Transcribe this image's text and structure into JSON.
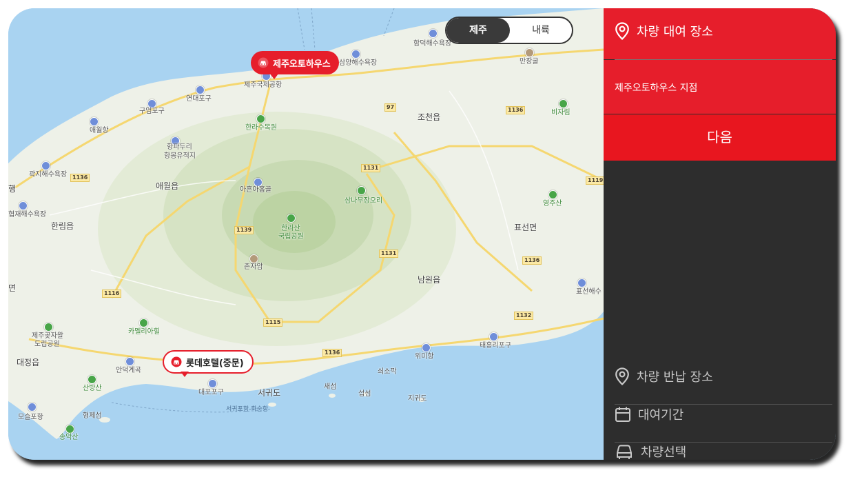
{
  "map": {
    "region_toggle": {
      "selected": "제주",
      "other": "내륙"
    },
    "markers": {
      "pickup": "제주오토하우스",
      "other": "롯데호텔(중문)"
    },
    "labels": {
      "airport": "제주국제공항",
      "hamdeok": "함덕해수욕장",
      "samyang": "삼양해수욕장",
      "manjang": "만장굴",
      "yeondae": "연대포구",
      "gueom": "구엄포구",
      "aewol_port": "애월항",
      "arboretum": "한라수목원",
      "jocheon": "조천읍",
      "bijarim": "비자림",
      "hangpadu1": "항파두리",
      "hangpadu2": "항몽유적지",
      "gwakji": "곽지해수욕장",
      "aewol": "애월읍",
      "hyeopjae": "협재해수욕장",
      "hallim": "한림읍",
      "aheun": "아흔아홉골",
      "samnun": "삼나무장오리",
      "hallasan1": "한라산",
      "hallasan2": "국립공원",
      "yeongju": "영주산",
      "pyoseon": "표선면",
      "jonjaam": "존자암",
      "namwon": "남원읍",
      "pyoseonhae": "표선해수",
      "jeju_got1": "제주곶자왈",
      "jeju_got2": "도립공원",
      "camellia": "카멜리아힐",
      "taeheung": "태흥리포구",
      "wimi": "위미항",
      "daejeong": "대정읍",
      "andeok": "안덕계곡",
      "sanbang": "산방산",
      "daepo": "대포포구",
      "seogwi": "서귀도",
      "saeseom": "새섬",
      "seopseom": "섭섬",
      "soesokkak": "쇠소깍",
      "jigwi": "지귀도",
      "moseulpo": "모슬포항",
      "hyeongje": "형제섬",
      "songak": "송악산",
      "ferry": "서귀포항-화순항",
      "myeon": "면",
      "haeng": "행"
    },
    "roads": [
      "97",
      "1136",
      "1136",
      "1131",
      "1131",
      "1139",
      "1119",
      "1136",
      "1116",
      "1115",
      "1132",
      "1136"
    ]
  },
  "panel": {
    "pickup_title": "차량 대여 장소",
    "pickup_value": "제주오토하우스 지점",
    "next_button": "다음",
    "steps": {
      "return_place": "차량 반납 장소",
      "rental_period": "대여기간",
      "car_select": "차량선택"
    }
  },
  "colors": {
    "brand_red": "#e61e2b",
    "panel_dark": "#2d2d2d",
    "sea": "#a9d3f1",
    "land": "#eef1e8"
  },
  "icons": [
    "pin-icon",
    "calendar-icon",
    "car-icon",
    "car-marker-icon"
  ]
}
